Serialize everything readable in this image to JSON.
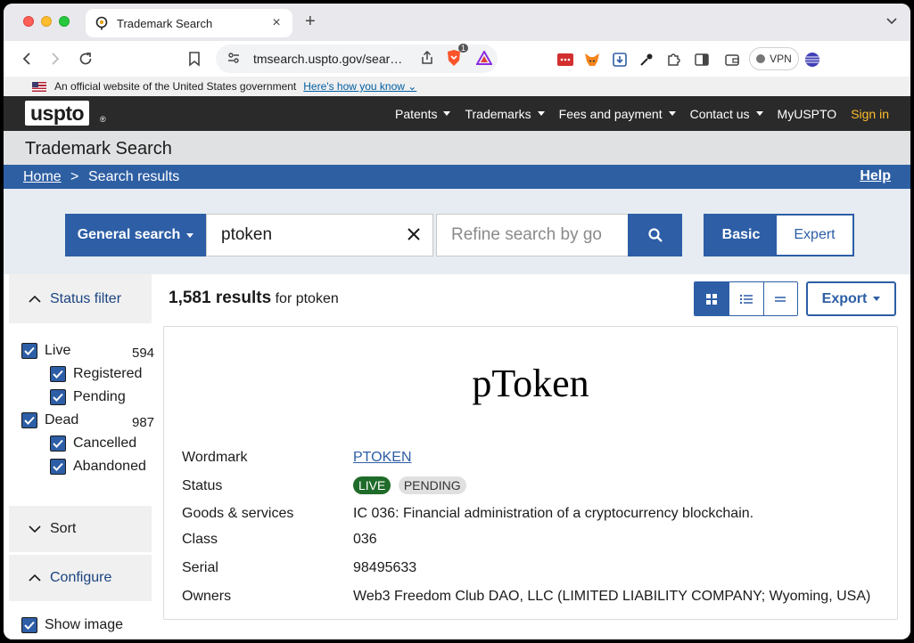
{
  "browser": {
    "tab_title": "Trademark Search",
    "url": "tmsearch.uspto.gov/sear…",
    "brave_badge": "1",
    "vpn_label": "VPN"
  },
  "gov_banner": {
    "text": "An official website of the United States government",
    "link": "Here's how you know"
  },
  "header": {
    "logo": "uspto",
    "logo_mark": "®",
    "nav": [
      "Patents",
      "Trademarks",
      "Fees and payment",
      "Contact us",
      "MyUSPTO"
    ],
    "sign_in": "Sign in"
  },
  "page_title": "Trademark Search",
  "breadcrumb": {
    "home": "Home",
    "separator": ">",
    "current": "Search results",
    "help": "Help"
  },
  "search": {
    "type_label": "General search",
    "query": "ptoken",
    "refine_placeholder": "Refine search by go",
    "mode_basic": "Basic",
    "mode_expert": "Expert"
  },
  "sidebar": {
    "status_filter_label": "Status filter",
    "filters": [
      {
        "label": "Live",
        "count": "594"
      },
      {
        "label": "Registered"
      },
      {
        "label": "Pending"
      },
      {
        "label": "Dead",
        "count": "987"
      },
      {
        "label": "Cancelled"
      },
      {
        "label": "Abandoned"
      }
    ],
    "sort_label": "Sort",
    "configure_label": "Configure",
    "show_image_label": "Show image"
  },
  "results": {
    "count": "1,581 results",
    "for_text": "for ptoken",
    "export_label": "Export"
  },
  "record": {
    "mark_image_text": "pToken",
    "labels": {
      "wordmark": "Wordmark",
      "status": "Status",
      "goods": "Goods & services",
      "class": "Class",
      "serial": "Serial",
      "owners": "Owners"
    },
    "wordmark": "PTOKEN",
    "status_live": "LIVE",
    "status_pending": "PENDING",
    "goods": "IC 036: Financial administration of a cryptocurrency blockchain.",
    "class": "036",
    "serial": "98495633",
    "owners": "Web3 Freedom Club DAO, LLC (LIMITED LIABILITY COMPANY; Wyoming, USA)"
  },
  "colors": {
    "primary_blue": "#2d5ea6",
    "header_dark": "#2a2a2a",
    "sign_in_gold": "#ffbe2e",
    "live_green": "#1f6b2a"
  }
}
